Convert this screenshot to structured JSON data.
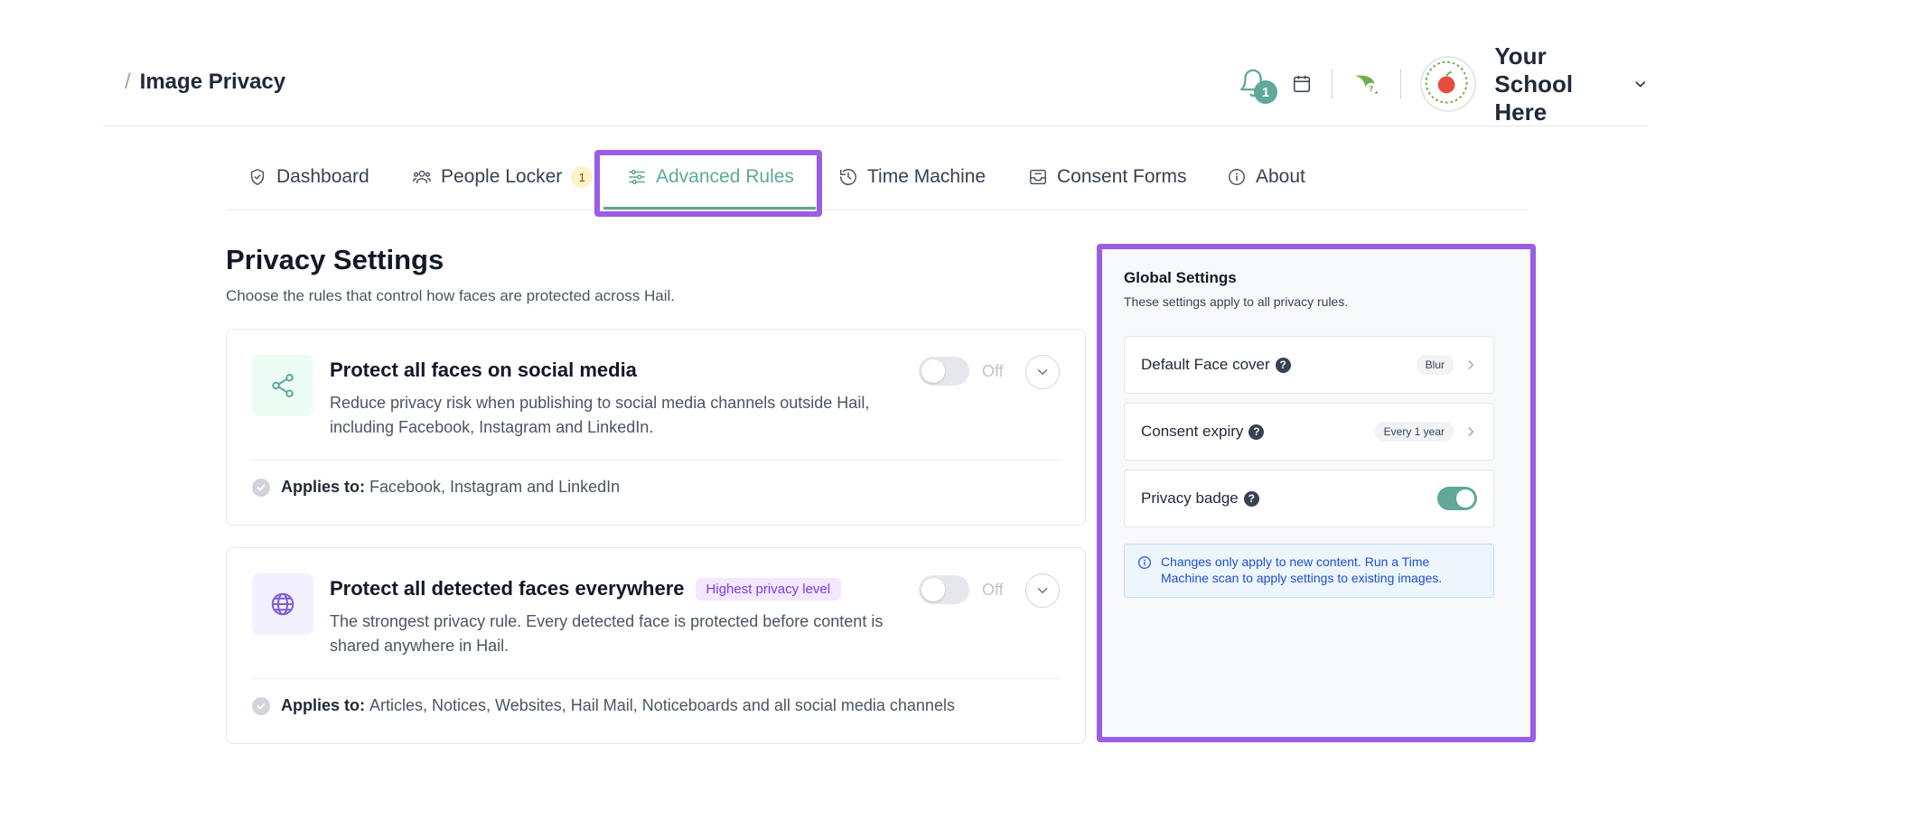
{
  "header": {
    "breadcrumb_sep": "/",
    "page_title": "Image Privacy",
    "notification_count": "1",
    "school_name": "Your School Here",
    "school_logo_text": "YOUR SCHOOL"
  },
  "tabs": [
    {
      "label": "Dashboard",
      "icon": "shield-check-icon"
    },
    {
      "label": "People Locker",
      "icon": "people-icon",
      "badge": "1"
    },
    {
      "label": "Advanced Rules",
      "icon": "sliders-icon",
      "active": true
    },
    {
      "label": "Time Machine",
      "icon": "history-icon"
    },
    {
      "label": "Consent Forms",
      "icon": "inbox-icon"
    },
    {
      "label": "About",
      "icon": "info-icon"
    }
  ],
  "main": {
    "title": "Privacy Settings",
    "subtitle": "Choose the rules that control how faces are protected across Hail."
  },
  "rules": [
    {
      "title": "Protect all faces on social media",
      "description": "Reduce privacy risk when publishing to social media channels outside Hail, including Facebook, Instagram and LinkedIn.",
      "toggle_label": "Off",
      "applies_label": "Applies to:",
      "applies_value": "Facebook, Instagram and LinkedIn",
      "icon": "share-icon"
    },
    {
      "title": "Protect all detected faces everywhere",
      "badge": "Highest privacy level",
      "description": "The strongest privacy rule. Every detected face is protected before content is shared anywhere in Hail.",
      "toggle_label": "Off",
      "applies_label": "Applies to:",
      "applies_value": "Articles, Notices, Websites, Hail Mail, Noticeboards and all social media channels",
      "icon": "globe-icon"
    }
  ],
  "global_settings": {
    "title": "Global Settings",
    "subtitle": "These settings apply to all privacy rules.",
    "rows": [
      {
        "label": "Default Face cover",
        "value": "Blur"
      },
      {
        "label": "Consent expiry",
        "value": "Every 1 year"
      },
      {
        "label": "Privacy badge",
        "enabled": true
      }
    ],
    "help_glyph": "?",
    "info": "Changes only apply to new content. Run a Time Machine scan to apply settings to existing images."
  },
  "colors": {
    "accent": "#5fa89a",
    "highlight": "#9b5de5",
    "badge_purple": "#7c3aed"
  }
}
